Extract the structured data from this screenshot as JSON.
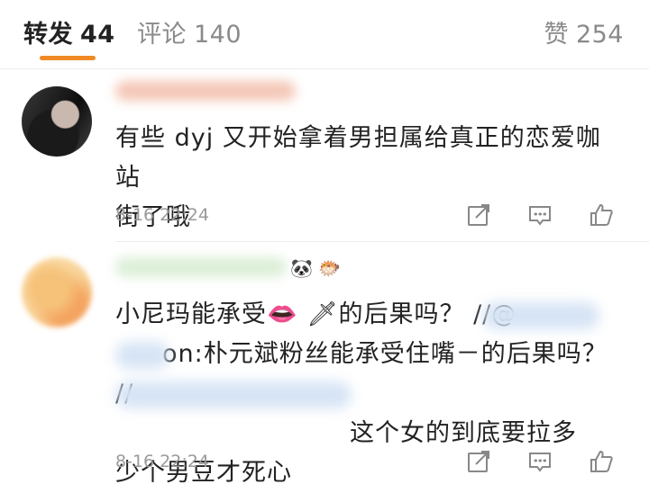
{
  "tabs": {
    "repost_label": "转发",
    "repost_count": "44",
    "comment_label": "评论",
    "comment_count": "140",
    "like_label": "赞",
    "like_count": "254"
  },
  "comments": [
    {
      "text_line1": "有些 dyj 又开始拿着男担属给真正的恋爱咖站",
      "text_line2": "街了哦",
      "time": "8-16 22:24"
    },
    {
      "emoji_badges": "🐼 🐡",
      "text_line1_a": "小尼玛能承受",
      "text_line1_emoji": "👄 🗡",
      "text_line1_b": "的后果吗？ //@",
      "text_line2_b": "on:朴元斌粉丝能承受住嘴－的后果吗？ //",
      "text_line3_b": "这个女的到底要拉多",
      "text_line4": "少个男豆才死心",
      "time": "8-16 22:24"
    }
  ],
  "icons": {
    "share": "share-icon",
    "reply": "comment-icon",
    "like": "thumbs-up-icon"
  },
  "colors": {
    "accent": "#f08a24",
    "mention": "#4f7cc9",
    "meta": "#9a9a9a"
  }
}
